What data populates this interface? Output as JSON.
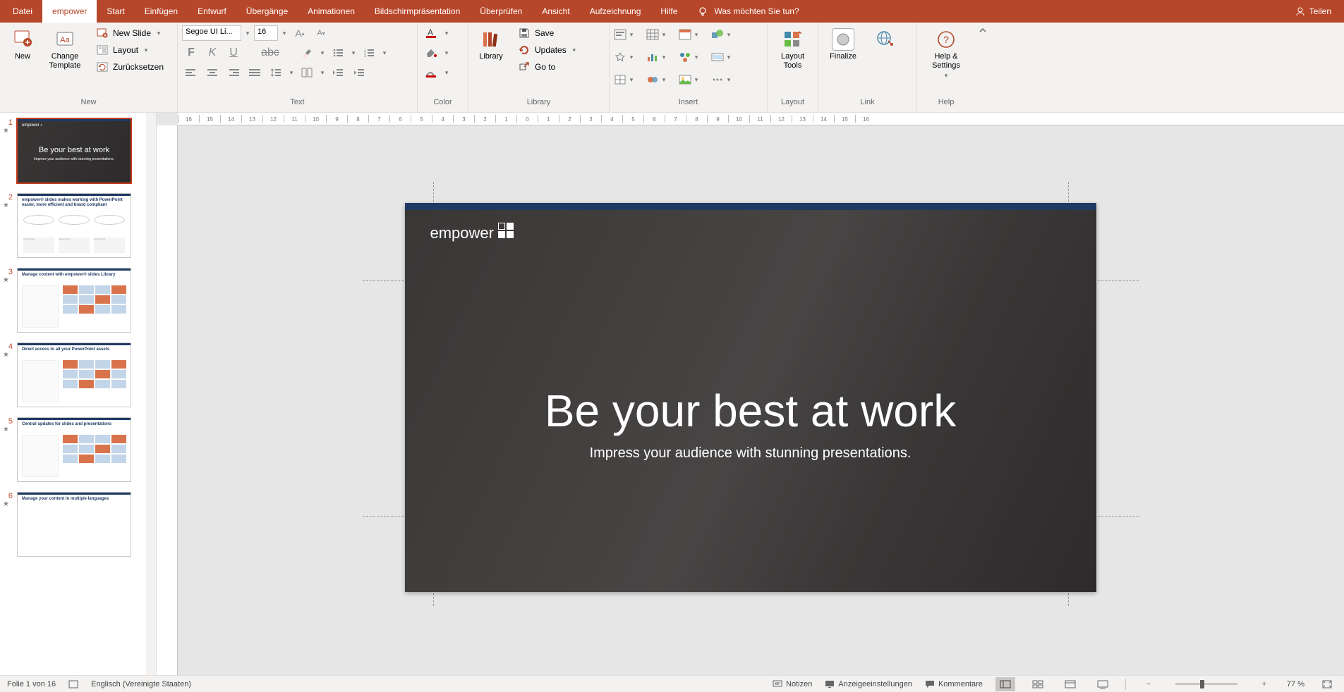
{
  "tabs": {
    "datei": "Datei",
    "empower": "empower",
    "start": "Start",
    "einfuegen": "Einfügen",
    "entwurf": "Entwurf",
    "uebergaenge": "Übergänge",
    "animationen": "Animationen",
    "bildschirm": "Bildschirmpräsentation",
    "ueberpruefen": "Überprüfen",
    "ansicht": "Ansicht",
    "aufzeichnung": "Aufzeichnung",
    "hilfe": "Hilfe",
    "tell_me": "Was möchten Sie tun?",
    "teilen": "Teilen"
  },
  "ribbon": {
    "new": {
      "label": "New",
      "new": "New",
      "change_template": "Change Template",
      "new_slide": "New Slide",
      "layout": "Layout",
      "reset": "Zurücksetzen"
    },
    "text": {
      "label": "Text",
      "font_name": "Segoe UI Li...",
      "font_size": "16"
    },
    "color": {
      "label": "Color"
    },
    "library": {
      "label": "Library",
      "library": "Library",
      "save": "Save",
      "updates": "Updates",
      "goto": "Go to"
    },
    "insert": {
      "label": "Insert"
    },
    "layout": {
      "label": "Layout",
      "layout_tools": "Layout Tools"
    },
    "link": {
      "label": "Link",
      "finalize": "Finalize"
    },
    "help": {
      "label": "Help",
      "help_settings": "Help & Settings"
    }
  },
  "thumbs": [
    {
      "n": "1",
      "title": "Be your best at work",
      "sub": "Impress your audience with stunning presentations.",
      "kind": "cover"
    },
    {
      "n": "2",
      "title": "empower® slides makes working with PowerPoint easier, more efficient and brand compliant",
      "kind": "three"
    },
    {
      "n": "3",
      "title": "Manage content with empower® slides Library",
      "kind": "gallery"
    },
    {
      "n": "4",
      "title": "Direct access to all your PowerPoint assets",
      "kind": "gallery"
    },
    {
      "n": "5",
      "title": "Central updates for slides and presentations",
      "kind": "gallery"
    },
    {
      "n": "6",
      "title": "Manage your content in multiple languages",
      "kind": "plain"
    }
  ],
  "slide": {
    "logo": "empower",
    "title": "Be your best at work",
    "subtitle": "Impress your audience with stunning presentations."
  },
  "status": {
    "page": "Folie 1 von 16",
    "lang": "Englisch (Vereinigte Staaten)",
    "notizen": "Notizen",
    "anzeige": "Anzeigeeinstellungen",
    "kommentare": "Kommentare",
    "zoom": "77 %"
  }
}
